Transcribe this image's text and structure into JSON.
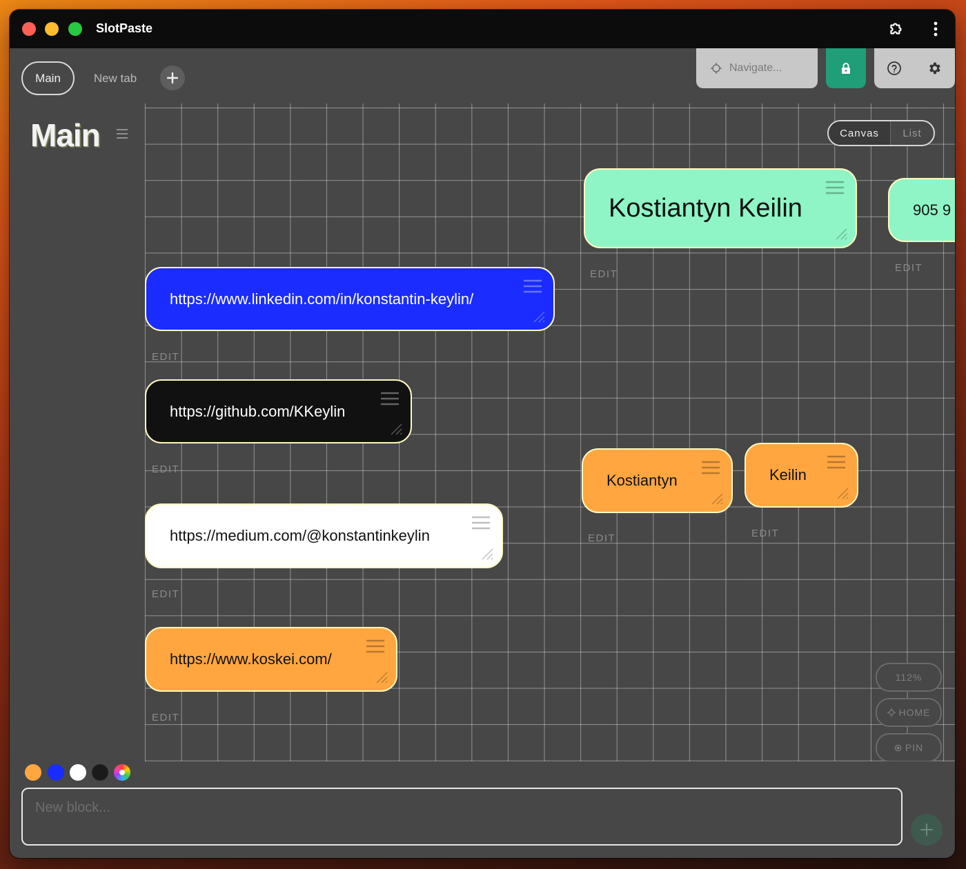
{
  "app": {
    "title": "SlotPaste"
  },
  "tabs": [
    {
      "label": "Main",
      "active": true
    },
    {
      "label": "New tab",
      "active": false
    }
  ],
  "navigate": {
    "placeholder": "Navigate..."
  },
  "page": {
    "title": "Main"
  },
  "view_toggle": {
    "canvas_label": "Canvas",
    "list_label": "List",
    "active": "Canvas"
  },
  "blocks": [
    {
      "text": "Kostiantyn Keilin",
      "color": "#8ff5c6",
      "text_color": "#111111",
      "edit_label": "EDIT"
    },
    {
      "text": "905 9",
      "color": "#8ff5c6",
      "text_color": "#111111",
      "edit_label": "EDIT"
    },
    {
      "text": "https://www.linkedin.com/in/konstantin-keylin/",
      "color": "#1a2cff",
      "text_color": "#ffffff",
      "edit_label": "EDIT"
    },
    {
      "text": "https://github.com/KKeylin",
      "color": "#111111",
      "text_color": "#ffffff",
      "edit_label": "EDIT"
    },
    {
      "text": "https://medium.com/@konstantinkeylin",
      "color": "#ffffff",
      "text_color": "#111111",
      "edit_label": "EDIT"
    },
    {
      "text": "https://www.koskei.com/",
      "color": "#ffa640",
      "text_color": "#111111",
      "edit_label": "EDIT"
    },
    {
      "text": "Kostiantyn",
      "color": "#ffa640",
      "text_color": "#111111",
      "edit_label": "EDIT"
    },
    {
      "text": "Keilin",
      "color": "#ffa640",
      "text_color": "#111111",
      "edit_label": "EDIT"
    }
  ],
  "canvas_controls": {
    "zoom": "112%",
    "home": "HOME",
    "pin": "PIN"
  },
  "palette": [
    "#ffa640",
    "#1a2cff",
    "#ffffff",
    "#1a1a1a",
    "rainbow"
  ],
  "composer": {
    "placeholder": "New block..."
  },
  "icons": {
    "extension": "puzzle-icon",
    "more": "more-vertical-icon",
    "add_tab": "plus-icon",
    "navigate": "crosshair-icon",
    "lock": "lock-icon",
    "help": "help-circle-icon",
    "settings": "gear-icon",
    "menu": "hamburger-icon",
    "drag": "drag-handle-icon",
    "resize": "resize-corner-icon"
  }
}
